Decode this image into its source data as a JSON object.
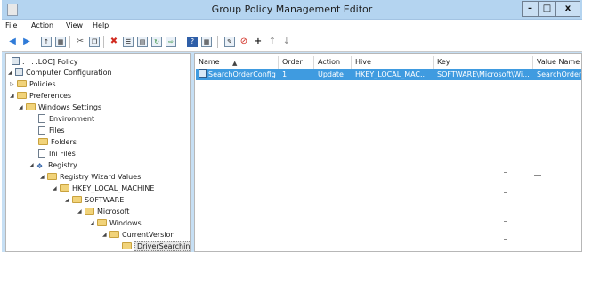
{
  "window": {
    "title": "Group Policy Management Editor",
    "min_label": "–",
    "max_label": "□",
    "close_label": "x"
  },
  "menubar": {
    "items": [
      "File",
      "Action",
      "View",
      "Help"
    ]
  },
  "toolbar": {
    "icons": [
      "back-icon",
      "forward-icon",
      "up-folder-icon",
      "show-hide-tree-icon",
      "cut-icon",
      "copy-icon",
      "delete-icon",
      "properties-icon",
      "print-icon",
      "refresh-icon",
      "export-icon",
      "help-icon",
      "console-icon",
      "new-item-icon",
      "stop-icon",
      "add-icon",
      "move-up-icon",
      "move-down-icon"
    ]
  },
  "tree": {
    "root_label": ". . .                .LOC] Policy",
    "items": [
      {
        "label": "Computer Configuration",
        "icon": "computer-config-icon",
        "expander": "◢"
      },
      {
        "label": "Policies",
        "icon": "folder-icon",
        "expander": "▷"
      },
      {
        "label": "Preferences",
        "icon": "folder-icon",
        "expander": "◢"
      },
      {
        "label": "Windows Settings",
        "icon": "folder-icon",
        "expander": "◢"
      },
      {
        "label": "Environment",
        "icon": "environment-icon",
        "expander": ""
      },
      {
        "label": "Files",
        "icon": "files-icon",
        "expander": ""
      },
      {
        "label": "Folders",
        "icon": "folders-icon",
        "expander": ""
      },
      {
        "label": "Ini Files",
        "icon": "ini-files-icon",
        "expander": ""
      },
      {
        "label": "Registry",
        "icon": "registry-icon",
        "expander": "◢"
      },
      {
        "label": "Registry Wizard Values",
        "icon": "folder-icon",
        "expander": "◢"
      },
      {
        "label": "HKEY_LOCAL_MACHINE",
        "icon": "folder-icon",
        "expander": "◢"
      },
      {
        "label": "SOFTWARE",
        "icon": "folder-icon",
        "expander": "◢"
      },
      {
        "label": "Microsoft",
        "icon": "folder-icon",
        "expander": "◢"
      },
      {
        "label": "Windows",
        "icon": "folder-icon",
        "expander": "◢"
      },
      {
        "label": "CurrentVersion",
        "icon": "folder-icon",
        "expander": "◢"
      },
      {
        "label": "DriverSearching",
        "icon": "folder-icon",
        "expander": "",
        "selected": true
      }
    ]
  },
  "list": {
    "columns": [
      "Name",
      "Order",
      "Action",
      "Hive",
      "Key",
      "Value Name"
    ],
    "rows": [
      {
        "name": "SearchOrderConfig",
        "order": "1",
        "action": "Update",
        "hive": "HKEY_LOCAL_MAC...",
        "key": "SOFTWARE\\Microsoft\\Wi...",
        "value_name": "SearchOrderC"
      }
    ]
  },
  "colors": {
    "window_frame": "#c6dff4",
    "titlebar": "#b4d4f0",
    "selection": "#3f9be0",
    "folder": "#f1d37a"
  }
}
